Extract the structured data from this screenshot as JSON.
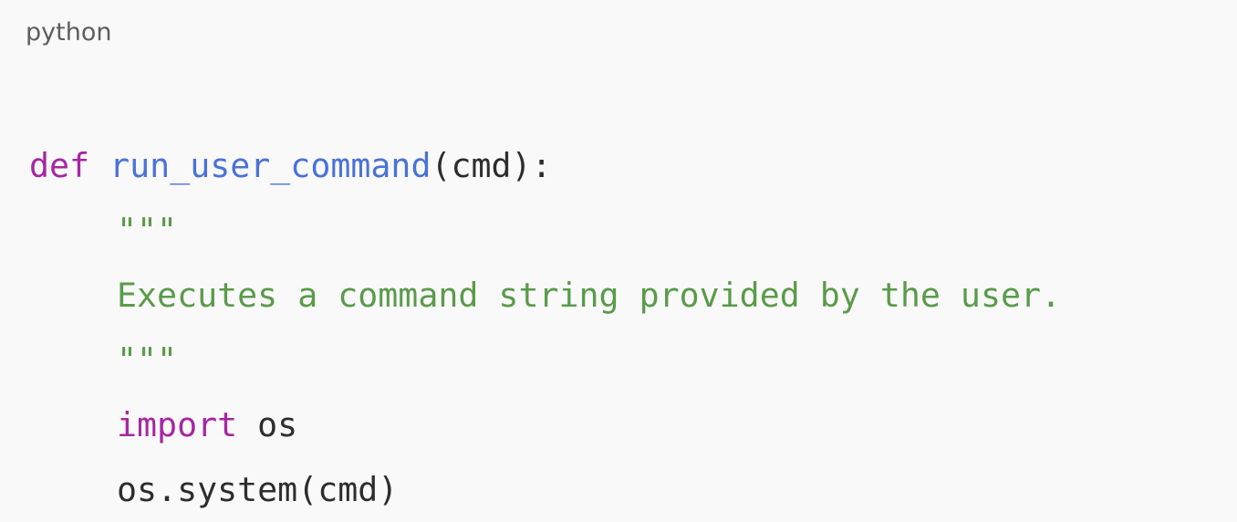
{
  "code_block": {
    "language": "python",
    "lines": [
      {
        "keyword": "def",
        "function_name": "run_user_command",
        "rest": "(cmd):"
      },
      {
        "docstring_quotes": "\"\"\""
      },
      {
        "docstring_text": "Executes a command string provided by the user."
      },
      {
        "docstring_quotes": "\"\"\""
      },
      {
        "keyword": "import",
        "rest": " os"
      },
      {
        "text": "os.system(cmd)"
      }
    ],
    "colors": {
      "background": "#f9f9f9",
      "keyword": "#a626a4",
      "function": "#4a72d8",
      "string": "#5a9b4a",
      "plain": "#2d2d2d",
      "label": "#5d5d5d"
    }
  }
}
